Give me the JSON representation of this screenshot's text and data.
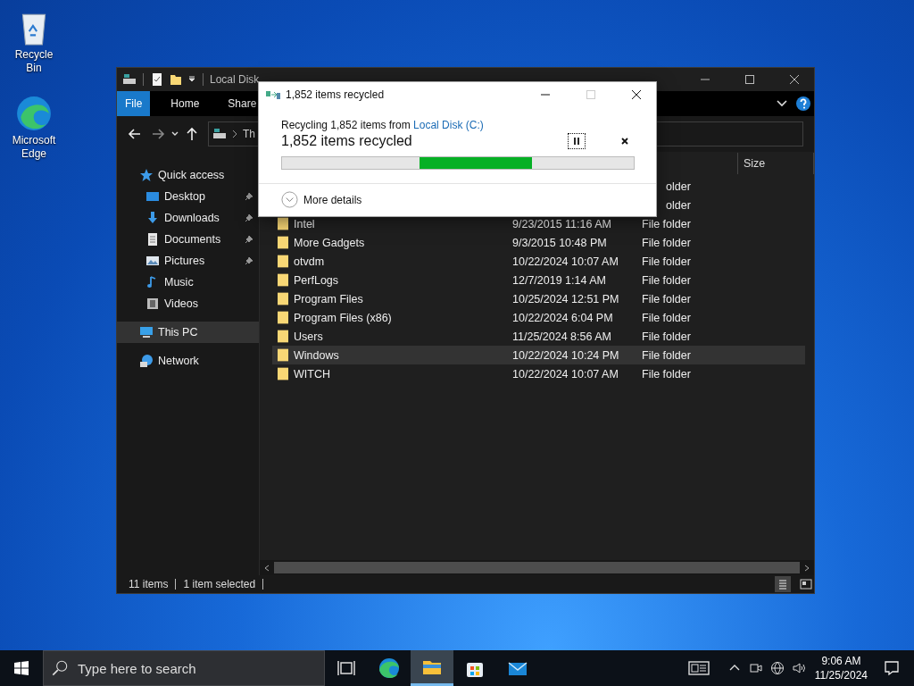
{
  "desktop_icons": [
    {
      "label": "Recycle Bin",
      "kind": "recycle"
    },
    {
      "label": "Microsoft Edge",
      "kind": "edge"
    }
  ],
  "explorer": {
    "title": "Local Disk",
    "ribbon_tabs": [
      {
        "label": "File",
        "selected": true
      },
      {
        "label": "Home",
        "selected": false
      },
      {
        "label": "Share",
        "selected": false
      }
    ],
    "address": "Th",
    "nav": [
      {
        "label": "Quick access",
        "kind": "star",
        "pinned": false,
        "selected": false,
        "children": [
          {
            "label": "Desktop",
            "kind": "desktop",
            "pinned": true,
            "selected": false
          },
          {
            "label": "Downloads",
            "kind": "download",
            "pinned": true,
            "selected": false
          },
          {
            "label": "Documents",
            "kind": "documents",
            "pinned": true,
            "selected": false
          },
          {
            "label": "Pictures",
            "kind": "pictures",
            "pinned": true,
            "selected": false
          },
          {
            "label": "Music",
            "kind": "music",
            "pinned": false,
            "selected": false
          },
          {
            "label": "Videos",
            "kind": "videos",
            "pinned": false,
            "selected": false
          }
        ]
      },
      {
        "label": "This PC",
        "kind": "pc",
        "pinned": false,
        "selected": true
      },
      {
        "label": "Network",
        "kind": "network",
        "pinned": false,
        "selected": false
      }
    ],
    "size_header": "Size",
    "rows": [
      {
        "type": "older",
        "selected": false
      },
      {
        "type": "older",
        "selected": false
      },
      {
        "name": "Intel",
        "date": "9/23/2015 11:16 AM",
        "type": "File folder",
        "selected": false
      },
      {
        "name": "More Gadgets",
        "date": "9/3/2015 10:48 PM",
        "type": "File folder",
        "selected": false
      },
      {
        "name": "otvdm",
        "date": "10/22/2024 10:07 AM",
        "type": "File folder",
        "selected": false
      },
      {
        "name": "PerfLogs",
        "date": "12/7/2019 1:14 AM",
        "type": "File folder",
        "selected": false
      },
      {
        "name": "Program Files",
        "date": "10/25/2024 12:51 PM",
        "type": "File folder",
        "selected": false
      },
      {
        "name": "Program Files (x86)",
        "date": "10/22/2024 6:04 PM",
        "type": "File folder",
        "selected": false
      },
      {
        "name": "Users",
        "date": "11/25/2024 8:56 AM",
        "type": "File folder",
        "selected": false
      },
      {
        "name": "Windows",
        "date": "10/22/2024 10:24 PM",
        "type": "File folder",
        "selected": true
      },
      {
        "name": "WITCH",
        "date": "10/22/2024 10:07 AM",
        "type": "File folder",
        "selected": false
      }
    ],
    "status": [
      "11 items",
      "1 item selected"
    ]
  },
  "dialog": {
    "title": "1,852 items recycled",
    "maximize_disabled": true,
    "description": "Recycling 1,852 items from",
    "source_link": "Local Disk (C:)",
    "heading": "1,852 items recycled",
    "details_label": "More details"
  },
  "taskbar": {
    "search_placeholder": "Type here to search",
    "apps": [
      {
        "kind": "taskview",
        "active": false
      },
      {
        "kind": "edge",
        "active": false
      },
      {
        "kind": "explorer",
        "active": true
      },
      {
        "kind": "store",
        "active": false
      },
      {
        "kind": "mail",
        "active": false
      }
    ],
    "time": "9:06 AM",
    "date": "11/25/2024"
  }
}
